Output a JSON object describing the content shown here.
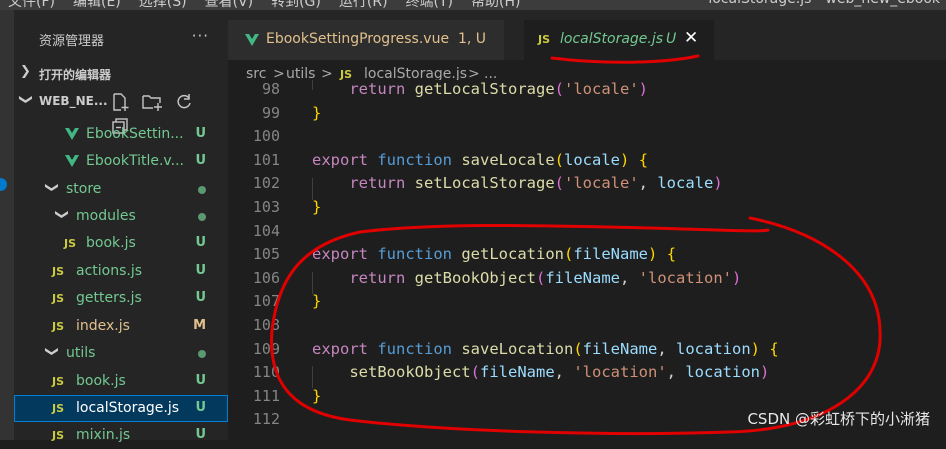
{
  "menubar": {
    "items": [
      "文件(F)",
      "编辑(E)",
      "选择(S)",
      "查看(V)",
      "转到(G)",
      "运行(R)",
      "终端(T)",
      "帮助(H)"
    ],
    "window_title": [
      "localStorage.js",
      "web_new_ebook"
    ]
  },
  "sidebar": {
    "title": "资源管理器",
    "more": "···",
    "open_editors": "打开的编辑器",
    "workspace": "WEB_NE...",
    "tree": [
      {
        "name": "EbookSettin...",
        "badge": "U",
        "kind": "vue"
      },
      {
        "name": "EbookTitle.v...",
        "badge": "U",
        "kind": "vue"
      },
      {
        "name": "store",
        "badge": "",
        "kind": "folder"
      },
      {
        "name": "modules",
        "badge": "",
        "kind": "folder"
      },
      {
        "name": "book.js",
        "badge": "U",
        "kind": "js"
      },
      {
        "name": "actions.js",
        "badge": "U",
        "kind": "js"
      },
      {
        "name": "getters.js",
        "badge": "U",
        "kind": "js"
      },
      {
        "name": "index.js",
        "badge": "M",
        "kind": "js"
      },
      {
        "name": "utils",
        "badge": "",
        "kind": "folder"
      },
      {
        "name": "book.js",
        "badge": "U",
        "kind": "js"
      },
      {
        "name": "localStorage.js",
        "badge": "U",
        "kind": "js"
      },
      {
        "name": "mixin.js",
        "badge": "U",
        "kind": "js"
      }
    ]
  },
  "tabs": [
    {
      "name": "EbookSettingProgress.vue",
      "status": "1, U",
      "icon": "vue-icon"
    },
    {
      "name": "localStorage.js",
      "status": "U",
      "icon": "js-icon",
      "close": "✕"
    }
  ],
  "icons": {
    "js_label": "JS"
  },
  "breadcrumb": [
    "src",
    ">",
    "utils",
    ">",
    "localStorage.js",
    ">",
    "..."
  ],
  "code": {
    "line_numbers": [
      "98",
      "99",
      "100",
      "101",
      "102",
      "103",
      "104",
      "105",
      "106",
      "107",
      "108",
      "109",
      "110",
      "111",
      "112"
    ],
    "lines": [
      [
        [
          "    ",
          "punc"
        ],
        [
          "return",
          "ctrl"
        ],
        [
          " ",
          "punc"
        ],
        [
          "getLocalStorage",
          "fn"
        ],
        [
          "(",
          "b2"
        ],
        [
          "'locale'",
          "str"
        ],
        [
          ")",
          "b2"
        ]
      ],
      [
        [
          "}",
          "b1"
        ]
      ],
      [],
      [
        [
          "export",
          "ctrl"
        ],
        [
          " ",
          "punc"
        ],
        [
          "function",
          "kw"
        ],
        [
          " ",
          "punc"
        ],
        [
          "saveLocale",
          "fn"
        ],
        [
          "(",
          "b1"
        ],
        [
          "locale",
          "param"
        ],
        [
          ")",
          "b1"
        ],
        [
          " ",
          "punc"
        ],
        [
          "{",
          "b1"
        ]
      ],
      [
        [
          "    ",
          "punc"
        ],
        [
          "return",
          "ctrl"
        ],
        [
          " ",
          "punc"
        ],
        [
          "setLocalStorage",
          "fn"
        ],
        [
          "(",
          "b2"
        ],
        [
          "'locale'",
          "str"
        ],
        [
          ", ",
          "punc"
        ],
        [
          "locale",
          "param"
        ],
        [
          ")",
          "b2"
        ]
      ],
      [
        [
          "}",
          "b1"
        ]
      ],
      [],
      [
        [
          "export",
          "ctrl"
        ],
        [
          " ",
          "punc"
        ],
        [
          "function",
          "kw"
        ],
        [
          " ",
          "punc"
        ],
        [
          "getLocation",
          "fn"
        ],
        [
          "(",
          "b1"
        ],
        [
          "fileName",
          "param"
        ],
        [
          ")",
          "b1"
        ],
        [
          " ",
          "punc"
        ],
        [
          "{",
          "b1"
        ]
      ],
      [
        [
          "    ",
          "punc"
        ],
        [
          "return",
          "ctrl"
        ],
        [
          " ",
          "punc"
        ],
        [
          "getBookObject",
          "fn"
        ],
        [
          "(",
          "b2"
        ],
        [
          "fileName",
          "param"
        ],
        [
          ", ",
          "punc"
        ],
        [
          "'location'",
          "str"
        ],
        [
          ")",
          "b2"
        ]
      ],
      [
        [
          "}",
          "b1"
        ]
      ],
      [],
      [
        [
          "export",
          "ctrl"
        ],
        [
          " ",
          "punc"
        ],
        [
          "function",
          "kw"
        ],
        [
          " ",
          "punc"
        ],
        [
          "saveLocation",
          "fn"
        ],
        [
          "(",
          "b1"
        ],
        [
          "fileName",
          "param"
        ],
        [
          ", ",
          "punc"
        ],
        [
          "location",
          "param"
        ],
        [
          ")",
          "b1"
        ],
        [
          " ",
          "punc"
        ],
        [
          "{",
          "b1"
        ]
      ],
      [
        [
          "    ",
          "punc"
        ],
        [
          "setBookObject",
          "fn"
        ],
        [
          "(",
          "b2"
        ],
        [
          "fileName",
          "param"
        ],
        [
          ", ",
          "punc"
        ],
        [
          "'location'",
          "str"
        ],
        [
          ", ",
          "punc"
        ],
        [
          "location",
          "param"
        ],
        [
          ")",
          "b2"
        ]
      ],
      [
        [
          "}",
          "b1"
        ]
      ],
      []
    ]
  },
  "watermark": "CSDN @彩虹桥下的小淅猪",
  "colors": {
    "accent": "#007acc",
    "annotation_red": "#e00000",
    "untracked": "#73c991",
    "modified": "#e2c08d"
  }
}
